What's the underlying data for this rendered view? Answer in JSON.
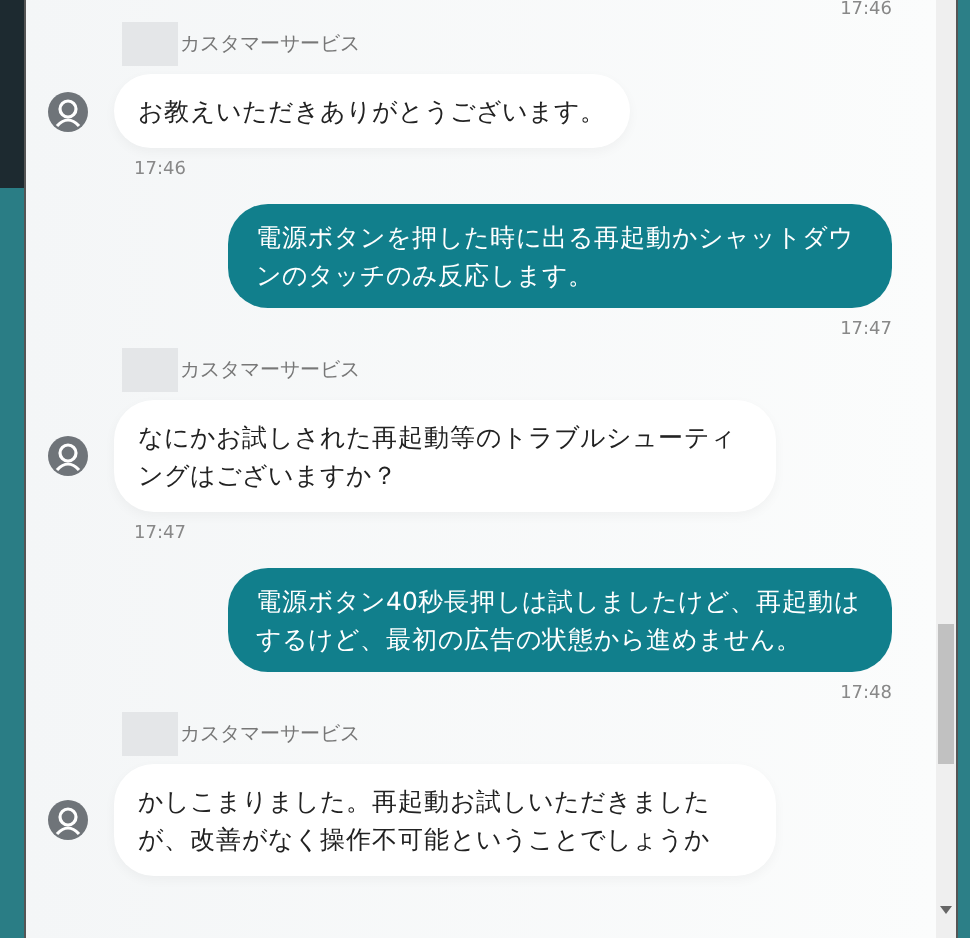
{
  "top_time": "17:46",
  "messages": [
    {
      "kind": "agent",
      "sender": "カスタマーサービス",
      "text": "お教えいただきありがとうございます。",
      "time": "17:46"
    },
    {
      "kind": "user",
      "text": "電源ボタンを押した時に出る再起動かシャットダウンのタッチのみ反応します。",
      "time": "17:47"
    },
    {
      "kind": "agent",
      "sender": "カスタマーサービス",
      "text": "なにかお試しされた再起動等のトラブルシューティングはございますか？",
      "time": "17:47"
    },
    {
      "kind": "user",
      "text": "電源ボタン40秒長押しは試しましたけど、再起動はするけど、最初の広告の状態から進めません。",
      "time": "17:48"
    },
    {
      "kind": "agent",
      "sender": "カスタマーサービス",
      "text": "かしこまりました。再起動お試しいただきましたが、改善がなく操作不可能ということでしょうか"
    }
  ]
}
